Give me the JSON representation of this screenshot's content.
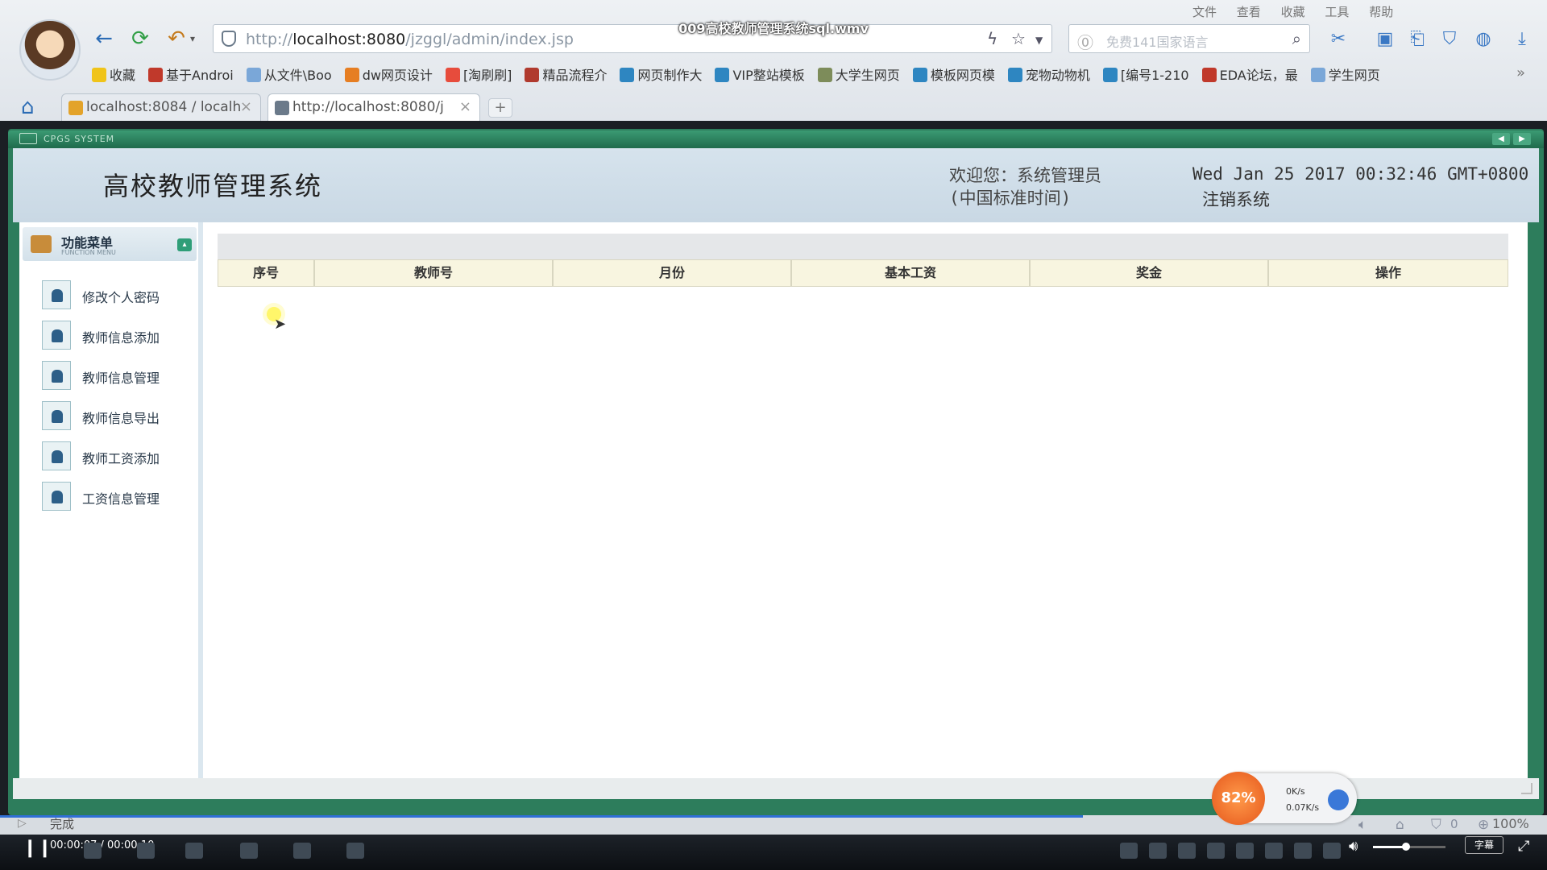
{
  "video": {
    "title": "009高校教师管理系统sql.wmv"
  },
  "browser": {
    "url_prefix": "http://",
    "url_host": "localhost:8080",
    "url_path": "/jzggl/admin/index.jsp",
    "search_placeholder": "免费141国家语言",
    "menu_items": [
      "文件",
      "查看",
      "收藏",
      "工具",
      "帮助"
    ],
    "bookmarks": [
      {
        "label": "收藏",
        "color": "#f0c419"
      },
      {
        "label": "基于Androi",
        "color": "#c0392b"
      },
      {
        "label": "从文件\\Boo",
        "color": "#7aa7d8"
      },
      {
        "label": "dw网页设计",
        "color": "#e67e22"
      },
      {
        "label": "[淘刷刷]",
        "color": "#e74c3c"
      },
      {
        "label": "精品流程介",
        "color": "#b03a2e"
      },
      {
        "label": "网页制作大",
        "color": "#2e86c1"
      },
      {
        "label": "VIP整站模板",
        "color": "#2e86c1"
      },
      {
        "label": "大学生网页",
        "color": "#7d8c5a"
      },
      {
        "label": "模板网页模",
        "color": "#2e86c1"
      },
      {
        "label": "宠物动物机",
        "color": "#2e86c1"
      },
      {
        "label": "[编号1-210",
        "color": "#2e86c1"
      },
      {
        "label": "EDA论坛，最",
        "color": "#c0392b"
      },
      {
        "label": "学生网页",
        "color": "#7aa7d8"
      }
    ],
    "tabs": [
      {
        "label": "localhost:8084 / localh",
        "color": "#e3a32a"
      },
      {
        "label": "http://localhost:8080/j",
        "color": "#6b7a8a"
      }
    ],
    "status_text": "完成",
    "zoom": "100%",
    "blocked_count": "0"
  },
  "app": {
    "window_title": "CPGS SYSTEM",
    "system_title": "高校教师管理系统",
    "welcome": "欢迎您：系统管理员\n(中国标准时间)",
    "datetime": "Wed Jan 25 2017 00:32:46 GMT+0800",
    "logout": "注销系统",
    "menu_title": "功能菜单",
    "menu_subtitle": "FUNCTION MENU",
    "sidebar_items": [
      {
        "label": "修改个人密码"
      },
      {
        "label": "教师信息添加"
      },
      {
        "label": "教师信息管理"
      },
      {
        "label": "教师信息导出"
      },
      {
        "label": "教师工资添加"
      },
      {
        "label": "工资信息管理"
      }
    ],
    "table": {
      "columns": [
        "序号",
        "教师号",
        "月份",
        "基本工资",
        "奖金",
        "操作"
      ],
      "rows": []
    }
  },
  "network": {
    "percent": "82%",
    "up": "0K/s",
    "down": "0.07K/s"
  },
  "player": {
    "time": "00:00:07 / 00:00:10",
    "subtitle_label": "字幕",
    "progress": 0.7
  }
}
